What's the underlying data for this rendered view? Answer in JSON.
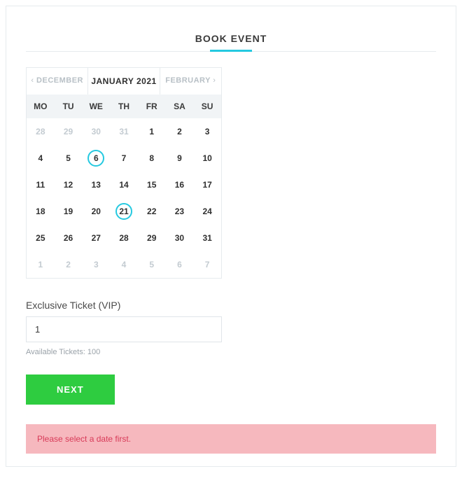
{
  "header": {
    "tab_label": "BOOK EVENT"
  },
  "calendar": {
    "prev_label": "DECEMBER",
    "title": "JANUARY 2021",
    "next_label": "FEBRUARY",
    "dow": [
      "MO",
      "TU",
      "WE",
      "TH",
      "FR",
      "SA",
      "SU"
    ],
    "weeks": [
      [
        {
          "n": "28",
          "out": true
        },
        {
          "n": "29",
          "out": true
        },
        {
          "n": "30",
          "out": true
        },
        {
          "n": "31",
          "out": true
        },
        {
          "n": "1"
        },
        {
          "n": "2"
        },
        {
          "n": "3"
        }
      ],
      [
        {
          "n": "4"
        },
        {
          "n": "5"
        },
        {
          "n": "6",
          "hl": true
        },
        {
          "n": "7"
        },
        {
          "n": "8"
        },
        {
          "n": "9"
        },
        {
          "n": "10"
        }
      ],
      [
        {
          "n": "11"
        },
        {
          "n": "12"
        },
        {
          "n": "13"
        },
        {
          "n": "14"
        },
        {
          "n": "15"
        },
        {
          "n": "16"
        },
        {
          "n": "17"
        }
      ],
      [
        {
          "n": "18"
        },
        {
          "n": "19"
        },
        {
          "n": "20"
        },
        {
          "n": "21",
          "hl": true
        },
        {
          "n": "22"
        },
        {
          "n": "23"
        },
        {
          "n": "24"
        }
      ],
      [
        {
          "n": "25"
        },
        {
          "n": "26"
        },
        {
          "n": "27"
        },
        {
          "n": "28"
        },
        {
          "n": "29"
        },
        {
          "n": "30"
        },
        {
          "n": "31"
        }
      ],
      [
        {
          "n": "1",
          "out": true
        },
        {
          "n": "2",
          "out": true
        },
        {
          "n": "3",
          "out": true
        },
        {
          "n": "4",
          "out": true
        },
        {
          "n": "5",
          "out": true
        },
        {
          "n": "6",
          "out": true
        },
        {
          "n": "7",
          "out": true
        }
      ]
    ]
  },
  "ticket": {
    "label": "Exclusive Ticket (VIP)",
    "value": "1",
    "available_text": "Available Tickets: 100"
  },
  "actions": {
    "next_label": "NEXT"
  },
  "alert": {
    "message": "Please select a date first."
  }
}
